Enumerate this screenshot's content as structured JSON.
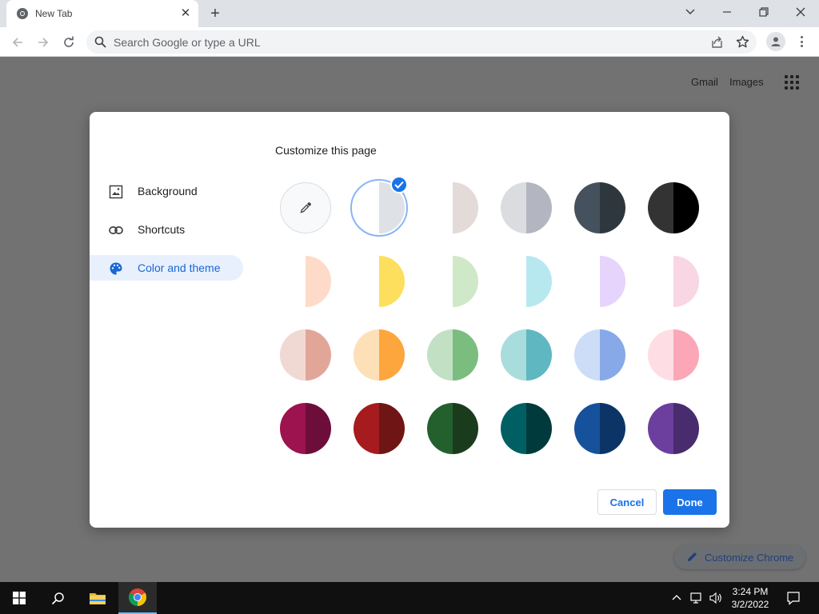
{
  "browser": {
    "tab_title": "New Tab",
    "tab_close": "✕",
    "new_tab": "+",
    "omnibox_placeholder": "Search Google or type a URL"
  },
  "page": {
    "gmail": "Gmail",
    "images": "Images"
  },
  "dialog": {
    "title": "Customize this page",
    "sidebar": [
      {
        "label": "Background",
        "icon": "image-icon",
        "active": false
      },
      {
        "label": "Shortcuts",
        "icon": "link-icon",
        "active": false
      },
      {
        "label": "Color and theme",
        "icon": "palette-icon",
        "active": true
      }
    ],
    "swatches": [
      [
        "custom",
        "custom"
      ],
      [
        "#ffffff",
        "#dee1e6"
      ],
      [
        "#ffffff",
        "#e3dbd8"
      ],
      [
        "#dadce0",
        "#b3b6c0"
      ],
      [
        "#45515c",
        "#2e363e"
      ],
      [
        "#333333",
        "#000000"
      ],
      [
        "#ffffff",
        "#fddbc8"
      ],
      [
        "#ffffff",
        "#fedf5d"
      ],
      [
        "#ffffff",
        "#cfe9c8"
      ],
      [
        "#ffffff",
        "#b7e8ef"
      ],
      [
        "#ffffff",
        "#e6d4fc"
      ],
      [
        "#ffffff",
        "#f9d6e3"
      ],
      [
        "#f1d9d3",
        "#e2a699"
      ],
      [
        "#fde0b8",
        "#fda63d"
      ],
      [
        "#c2e0c4",
        "#7bbd7f"
      ],
      [
        "#a9dcdd",
        "#5fb7c1"
      ],
      [
        "#cddcf7",
        "#87a9e8"
      ],
      [
        "#fedde4",
        "#fba7b8"
      ],
      [
        "#9c1350",
        "#6d0e3a"
      ],
      [
        "#a51b1e",
        "#6f1515"
      ],
      [
        "#24602e",
        "#1a3c1d"
      ],
      [
        "#005f63",
        "#003a3c"
      ],
      [
        "#16529b",
        "#0d3466"
      ],
      [
        "#6c3f9e",
        "#482c6e"
      ]
    ],
    "selected_index": 1,
    "cancel": "Cancel",
    "done": "Done"
  },
  "customize_chrome": "Customize Chrome",
  "taskbar": {
    "time": "3:24 PM",
    "date": "3/2/2022"
  }
}
